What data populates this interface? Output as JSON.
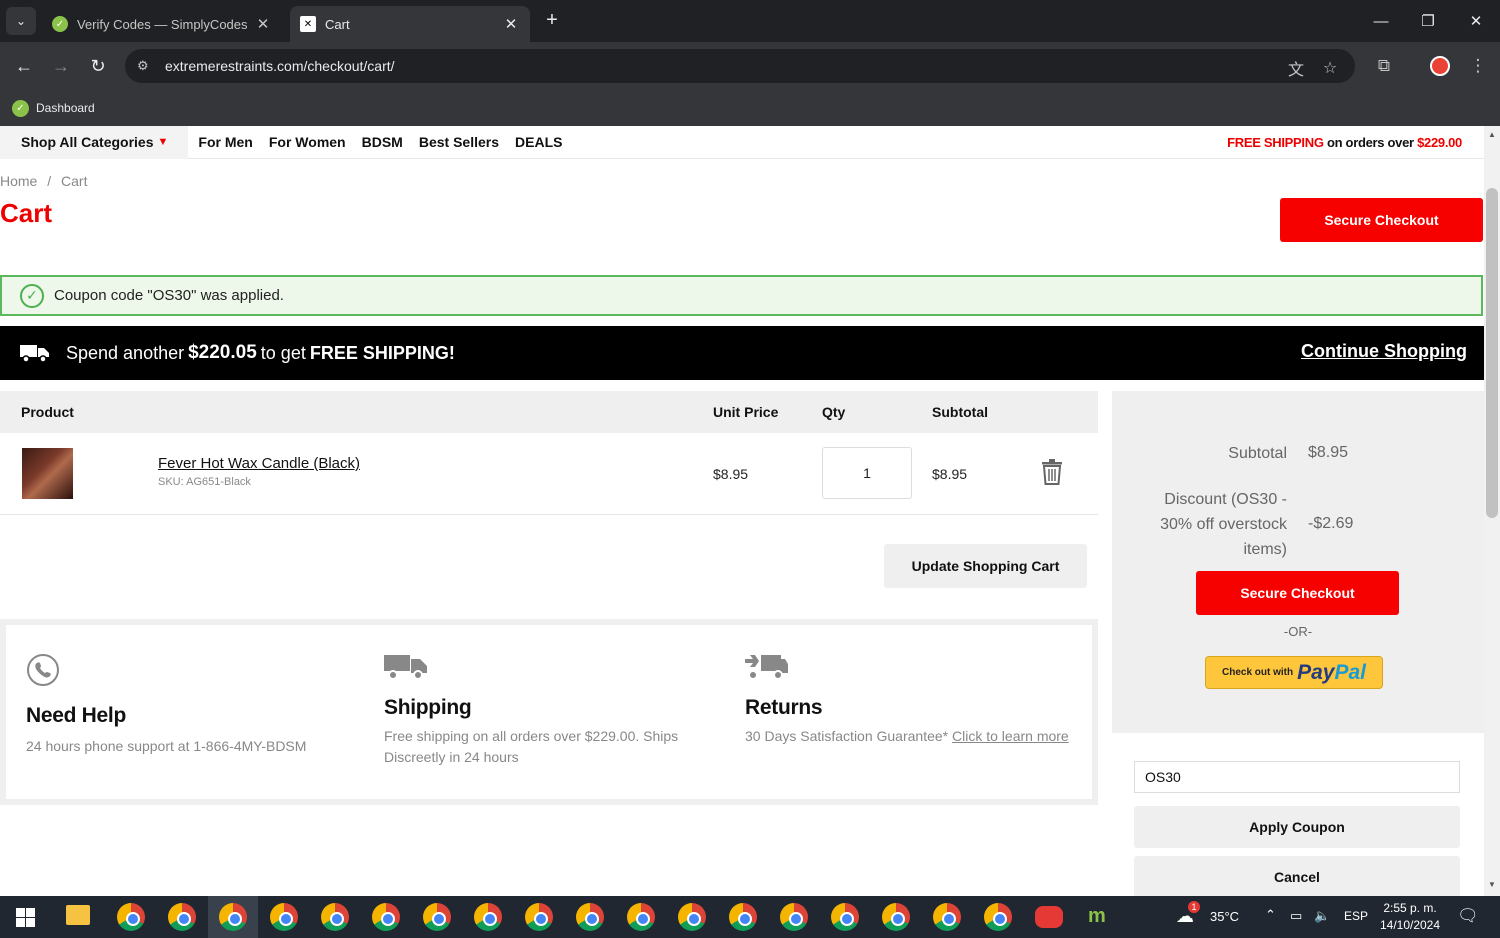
{
  "browser": {
    "tabs": [
      {
        "title": "Verify Codes — SimplyCodes",
        "active": false
      },
      {
        "title": "Cart",
        "active": true
      }
    ],
    "url": "extremerestraints.com/checkout/cart/",
    "bookmarks": [
      {
        "label": "Dashboard"
      }
    ]
  },
  "nav": {
    "shop_all": "Shop All Categories",
    "links": [
      "For Men",
      "For Women",
      "BDSM",
      "Best Sellers",
      "DEALS"
    ],
    "free_shipping_red": "FREE SHIPPING",
    "free_shipping_text": "on orders over",
    "free_shipping_amount": "$229.00"
  },
  "breadcrumb": {
    "home": "Home",
    "sep": "/",
    "current": "Cart"
  },
  "page_title": "Cart",
  "secure_checkout": "Secure Checkout",
  "notice": "Coupon code \"OS30\" was applied.",
  "shipping_bar": {
    "spend": "Spend another",
    "amount": "$220.05",
    "to_get": "to get",
    "free": "FREE SHIPPING!",
    "continue": "Continue Shopping"
  },
  "cart": {
    "headers": {
      "product": "Product",
      "unit_price": "Unit Price",
      "qty": "Qty",
      "subtotal": "Subtotal"
    },
    "items": [
      {
        "name": "Fever Hot Wax Candle (Black)",
        "sku": "SKU: AG651-Black",
        "price": "$8.95",
        "qty": "1",
        "subtotal": "$8.95"
      }
    ],
    "update_button": "Update Shopping Cart"
  },
  "info": {
    "help": {
      "title": "Need Help",
      "text": "24 hours phone support at 1-866-4MY-BDSM"
    },
    "shipping": {
      "title": "Shipping",
      "line1": "Free shipping on all orders over $229.00. Ships",
      "line2": "Discreetly in 24 hours"
    },
    "returns": {
      "title": "Returns",
      "text": "30 Days Satisfaction Guarantee*",
      "link": "Click to learn more"
    }
  },
  "summary": {
    "subtotal_label": "Subtotal",
    "subtotal_value": "$8.95",
    "discount_line1": "Discount (OS30 -",
    "discount_line2": "30% off overstock",
    "discount_line3": "items)",
    "discount_value": "-$2.69",
    "or": "-OR-",
    "paypal_small": "Check out with",
    "paypal_pay": "Pay",
    "paypal_pal": "Pal"
  },
  "coupon": {
    "value": "OS30",
    "apply": "Apply Coupon",
    "cancel": "Cancel"
  },
  "taskbar": {
    "weather": "35°C",
    "lang": "ESP",
    "time": "2:55 p. m.",
    "date": "14/10/2024",
    "weather_badge": "1"
  },
  "colors": {
    "brand_red": "#f70000",
    "success_green": "#5cb85c"
  }
}
